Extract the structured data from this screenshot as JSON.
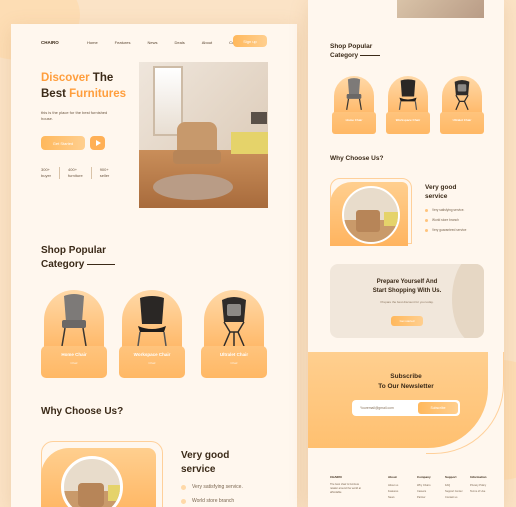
{
  "left": {
    "nav": {
      "logo": "CHAIRO",
      "links": [
        "Home",
        "Features",
        "News",
        "Deals",
        "About",
        "Contact"
      ],
      "signup": "Sign up"
    },
    "hero": {
      "title_highlight_1": "Discover",
      "title_rest_1": "The",
      "title_line2_plain": "Best",
      "title_line2_highlight": "Furnitures",
      "subtitle": "this is the place for the best furnished house.",
      "cta": "Get Started",
      "stats": [
        {
          "value": "300+",
          "label": "buyer"
        },
        {
          "value": "400+",
          "label": "furniture"
        },
        {
          "value": "900+",
          "label": "seller"
        }
      ]
    },
    "category": {
      "title_line1": "Shop Popular",
      "title_line2": "Category",
      "cards": [
        {
          "label": "Home Chair",
          "sub": "Chair"
        },
        {
          "label": "Workspace Chair",
          "sub": "Chair"
        },
        {
          "label": "Ultralet Chair",
          "sub": "Chair"
        }
      ]
    },
    "why": {
      "title": "Why Choose  Us?",
      "panel_title_1": "Very good",
      "panel_title_2": "service",
      "bullets": [
        "Very satisfying service.",
        "World store branch"
      ]
    }
  },
  "right": {
    "category": {
      "title_line1": "Shop Popular",
      "title_line2": "Category",
      "cards": [
        {
          "label": "Home Chair"
        },
        {
          "label": "Workspace Chair"
        },
        {
          "label": "Ultralet Chair"
        }
      ]
    },
    "why": {
      "title": "Why Choose  Us?",
      "panel_title_1": "Very good",
      "panel_title_2": "service",
      "bullets": [
        "Very satisfying service.",
        "World store branch",
        "Very guaranteed service"
      ]
    },
    "prepare": {
      "title_1": "Prepare Yourself And",
      "title_2": "Start Shopping With Us.",
      "sub": "Prepare the best discount for you today.",
      "button": "Get started"
    },
    "subscribe": {
      "title_1": "Subscribe",
      "title_2": "To Our Newsletter",
      "placeholder": "Youremail@gmail.com",
      "button": "Subscribe"
    },
    "footer": {
      "brand": "CHAIRO",
      "brand_desc": "The best chair & furniture retailer around the world at affordable",
      "cols": [
        {
          "head": "About",
          "items": [
            "About us",
            "Features",
            "News"
          ]
        },
        {
          "head": "Company",
          "items": [
            "Why Chairo",
            "Careers",
            "Partner"
          ]
        },
        {
          "head": "Support",
          "items": [
            "FAQ",
            "Support Center",
            "Contact us"
          ]
        },
        {
          "head": "Information",
          "items": [
            "Privacy Policy",
            "Terms of Use"
          ]
        }
      ]
    }
  },
  "colors": {
    "accent": "#ff9e3d",
    "accent_light": "#ffcf8f",
    "background": "#fff7ee",
    "page": "#fbe3c6"
  }
}
